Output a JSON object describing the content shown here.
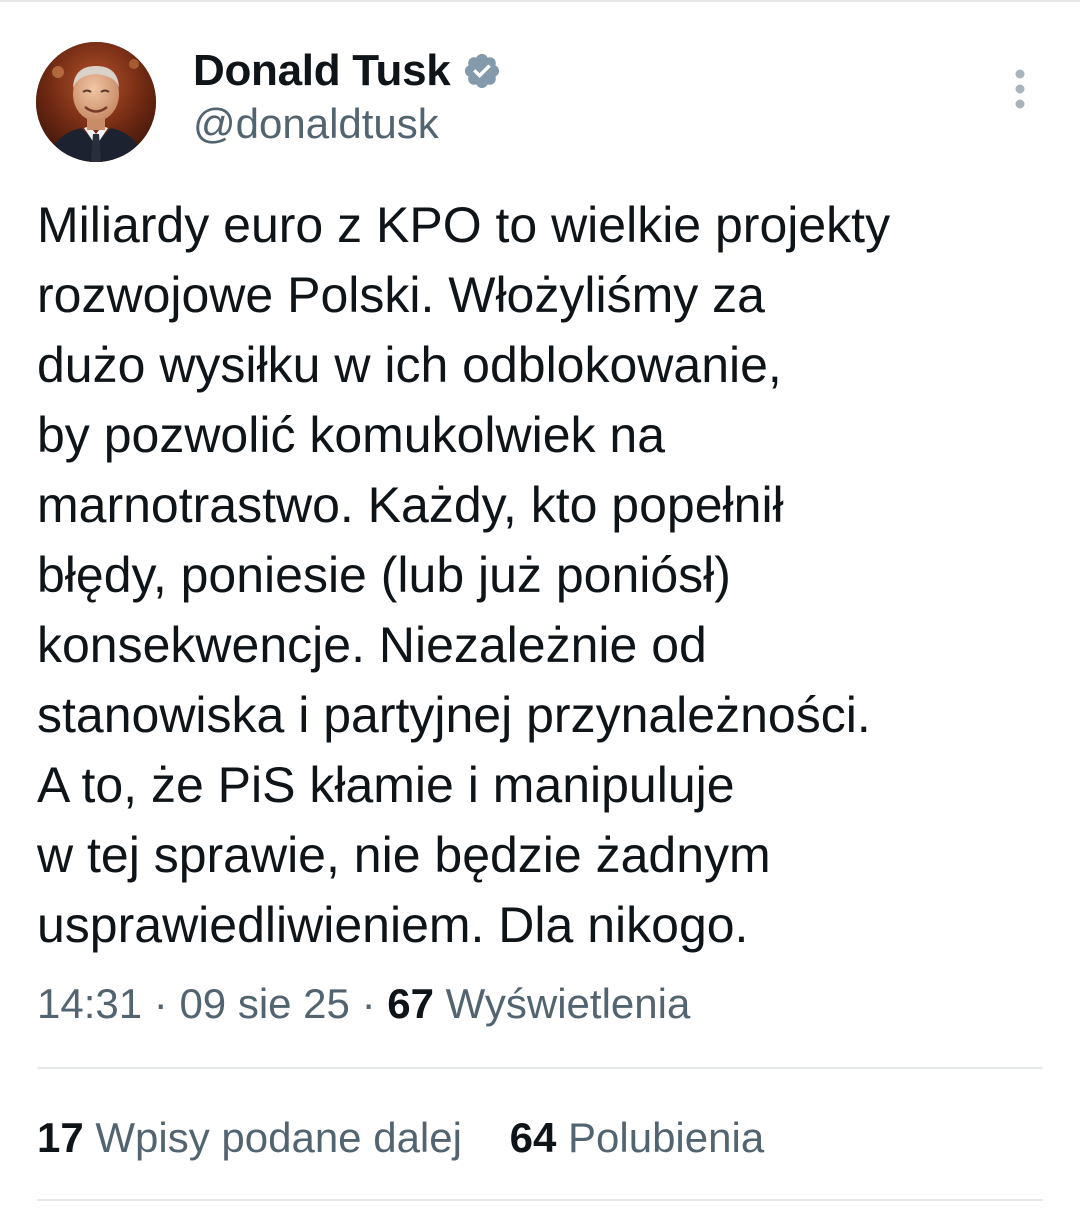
{
  "author": {
    "name": "Donald Tusk",
    "handle": "@donaldtusk",
    "verified": true
  },
  "icons": {
    "verified": "verified-badge-icon",
    "more": "more-vertical-icon"
  },
  "colors": {
    "text": "#0f1419",
    "secondary": "#536471",
    "verified_badge": "#829aab",
    "divider": "#e6e9ec"
  },
  "tweet": {
    "lines": [
      "Miliardy euro z KPO to wielkie projekty",
      "rozwojowe Polski. Włożyliśmy za",
      "dużo wysiłku w ich odblokowanie,",
      "by pozwolić komukolwiek na",
      "marnotrastwo. Każdy, kto popełnił",
      "błędy, poniesie (lub już poniósł)",
      "konsekwencje. Niezależnie od",
      "stanowiska i partyjnej przynależności.",
      "A to, że PiS kłamie i manipuluje",
      "w tej sprawie, nie będzie żadnym",
      "usprawiedliwieniem. Dla nikogo."
    ]
  },
  "meta": {
    "time": "14:31",
    "date": "09 sie 25",
    "separator": " · ",
    "views_count": "67",
    "views_label": "Wyświetlenia"
  },
  "stats": {
    "reposts_count": "17",
    "reposts_label": "Wpisy podane dalej",
    "likes_count": "64",
    "likes_label": "Polubienia"
  }
}
